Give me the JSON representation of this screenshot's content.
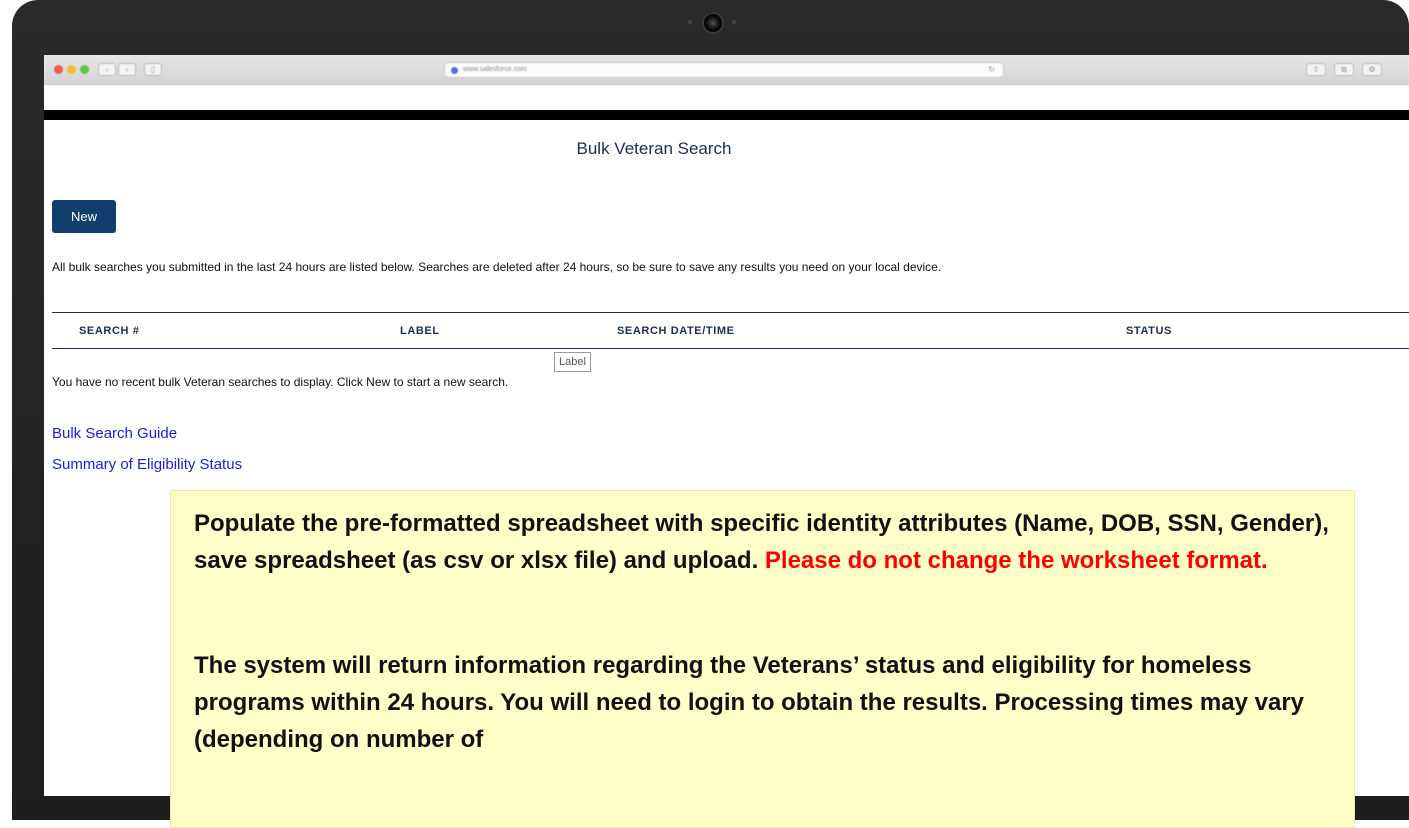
{
  "browser": {
    "url": "www.salesforce.com"
  },
  "page": {
    "title": "Bulk Veteran Search",
    "new_button": "New",
    "info_text": "All bulk searches you submitted in the last 24 hours are listed below. Searches are deleted after 24 hours, so be sure to save any results you need on your local device.",
    "table": {
      "columns": [
        "SEARCH #",
        "LABEL",
        "SEARCH DATE/TIME",
        "STATUS"
      ]
    },
    "tooltip": "Label",
    "empty_message": "You have no recent bulk Veteran searches to display. Click New to start a new search.",
    "links": [
      "Bulk Search Guide",
      "Summary of Eligibility Status"
    ]
  },
  "callout": {
    "paragraph1": "Populate the pre-formatted spreadsheet with specific identity attributes (Name, DOB, SSN, Gender), save spreadsheet (as csv or xlsx file) and upload. ",
    "warning": "Please do not change the worksheet format.",
    "paragraph2": "The system will return information regarding the Veterans’ status and eligibility for homeless programs within 24 hours. You will need to login to obtain the results. Processing times may vary (depending on number of"
  },
  "colors": {
    "header_navy": "#1b2f4a",
    "button_blue": "#123e6e",
    "link_blue": "#1a1ae6",
    "callout_bg": "#ffffc8",
    "warning_red": "#ff0000"
  }
}
